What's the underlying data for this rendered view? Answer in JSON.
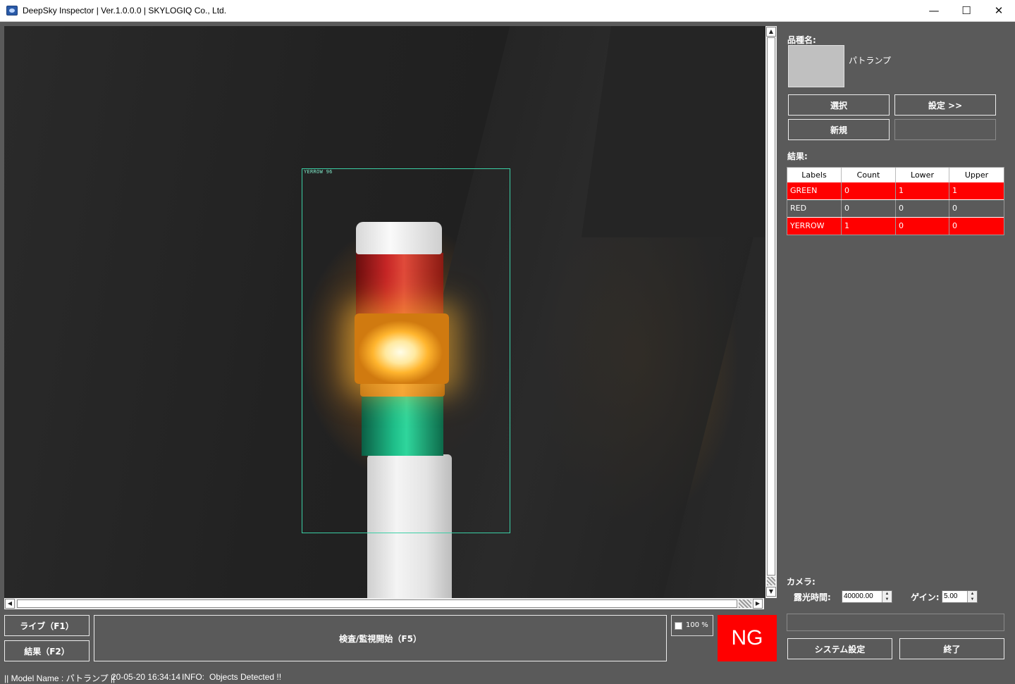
{
  "window": {
    "title": "DeepSky Inspector | Ver.1.0.0.0 | SKYLOGIQ Co., Ltd.",
    "minimize_glyph": "—",
    "maximize_glyph": "☐",
    "close_glyph": "✕"
  },
  "viewport": {
    "detection_label": "YERROW 96"
  },
  "scrollbars": {
    "up": "▲",
    "down": "▼",
    "left": "◀",
    "right": "▶"
  },
  "product": {
    "label": "品種名:",
    "name": "パトランプ",
    "select_button": "選択",
    "settings_button": "設定 >>",
    "new_button": "新規"
  },
  "results": {
    "label": "結果:",
    "columns": [
      "Labels",
      "Count",
      "Lower",
      "Upper"
    ],
    "rows": [
      {
        "label": "GREEN",
        "count": "0",
        "lower": "1",
        "upper": "1",
        "status": "ng"
      },
      {
        "label": "RED",
        "count": "0",
        "lower": "0",
        "upper": "0",
        "status": "ok"
      },
      {
        "label": "YERROW",
        "count": "1",
        "lower": "0",
        "upper": "0",
        "status": "ng"
      }
    ]
  },
  "camera": {
    "label": "カメラ:",
    "exposure_label": "露光時間:",
    "exposure_value": "40000.00",
    "gain_label": "ゲイン:",
    "gain_value": "5.00",
    "spin_up": "▲",
    "spin_down": "▼"
  },
  "buttons": {
    "live": "ライブ（F1）",
    "result": "結果（F2）",
    "inspect": "検査/監視開始（F5）",
    "system_settings": "システム設定",
    "exit": "終了"
  },
  "zoom": {
    "value": "100 %"
  },
  "judgement": {
    "text": "NG"
  },
  "status": {
    "model": "|| Model Name : パトランプ ||",
    "timestamp": "20-05-20 16:34:14",
    "info_label": "INFO:",
    "info_message": "Objects Detected !!"
  },
  "colors": {
    "background": "#5a5a5a",
    "ng": "#ff0000",
    "bbox": "#3bcfa5"
  }
}
